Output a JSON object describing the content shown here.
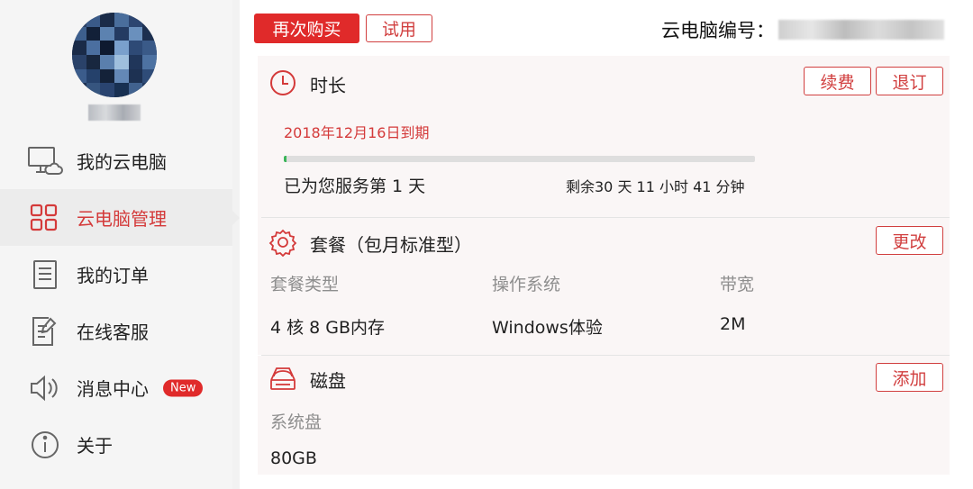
{
  "sidebar": {
    "items": [
      {
        "label": "我的云电脑",
        "icon": "cloud-computer-icon"
      },
      {
        "label": "云电脑管理",
        "icon": "grid-icon",
        "active": true
      },
      {
        "label": "我的订单",
        "icon": "document-icon"
      },
      {
        "label": "在线客服",
        "icon": "edit-document-icon"
      },
      {
        "label": "消息中心",
        "icon": "speaker-icon",
        "badge": "New"
      },
      {
        "label": "关于",
        "icon": "info-icon"
      }
    ]
  },
  "toolbar": {
    "buy_again_label": "再次购买",
    "trial_label": "试用",
    "machine_id_label": "云电脑编号："
  },
  "duration": {
    "title": "时长",
    "renew_label": "续费",
    "unsubscribe_label": "退订",
    "expire_text": "2018年12月16日到期",
    "progress": 0.005,
    "served_text": "已为您服务第 1 天",
    "remaining_text": "剩余30 天 11 小时 41 分钟"
  },
  "package": {
    "title": "套餐（包月标准型）",
    "change_label": "更改",
    "columns": [
      {
        "label": "套餐类型",
        "value": "4 核 8 GB内存"
      },
      {
        "label": "操作系统",
        "value": "Windows体验"
      },
      {
        "label": "带宽",
        "value": "2M"
      }
    ]
  },
  "disk": {
    "title": "磁盘",
    "add_label": "添加",
    "system_disk_label": "系统盘",
    "system_disk_value": "80GB"
  },
  "colors": {
    "accent": "#e02a2a",
    "progress": "#3cb55a"
  }
}
